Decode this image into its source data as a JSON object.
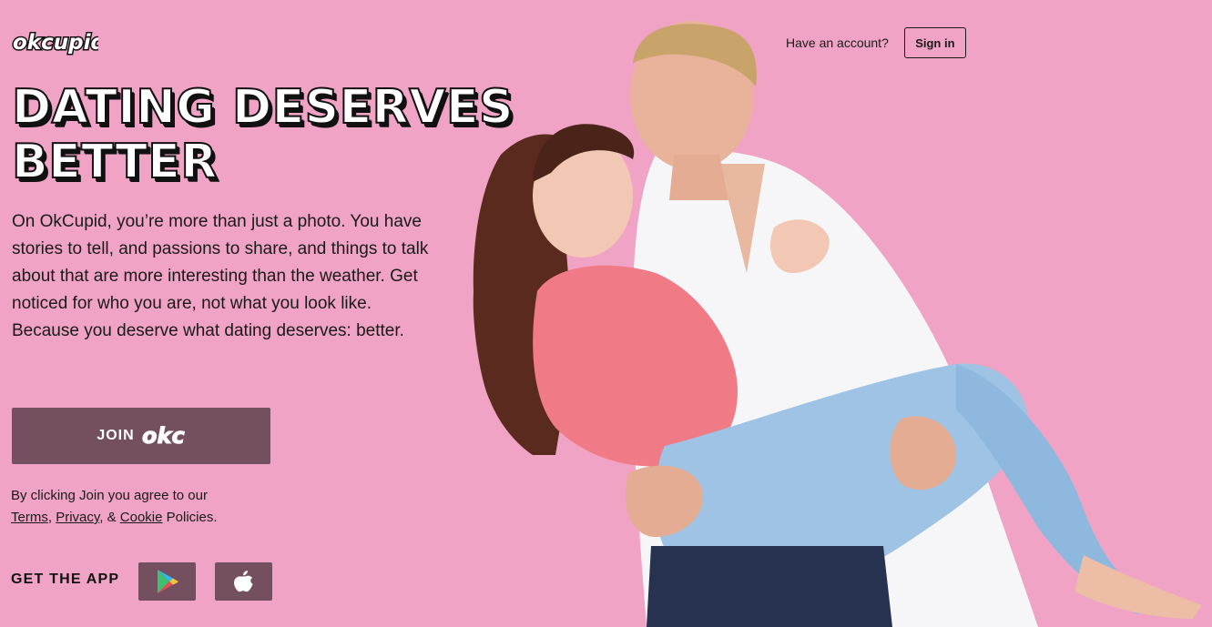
{
  "brand": {
    "logo_text": "okcupid",
    "accent_color": "#734f5f",
    "background_color": "#f0a3c4"
  },
  "header": {
    "have_account": "Have an account?",
    "sign_in": "Sign in"
  },
  "hero": {
    "headline_line1": "DATING DESERVES",
    "headline_line2": "BETTER",
    "intro": "On OkCupid, you’re more than just a photo. You have stories to tell, and passions to share, and things to talk about that are more interesting than the weather. Get noticed for who you are, not what you look like. Because you deserve what dating deserves: better."
  },
  "join": {
    "label": "JOIN",
    "logo_text": "okc"
  },
  "legal": {
    "prefix": "By clicking Join you agree to our",
    "terms": "Terms",
    "sep1": ",",
    "privacy": "Privacy",
    "sep2": ", &",
    "cookie": "Cookie",
    "suffix": "Policies."
  },
  "app": {
    "label": "GET THE APP",
    "google_icon": "google-play-icon",
    "apple_icon": "apple-icon"
  }
}
